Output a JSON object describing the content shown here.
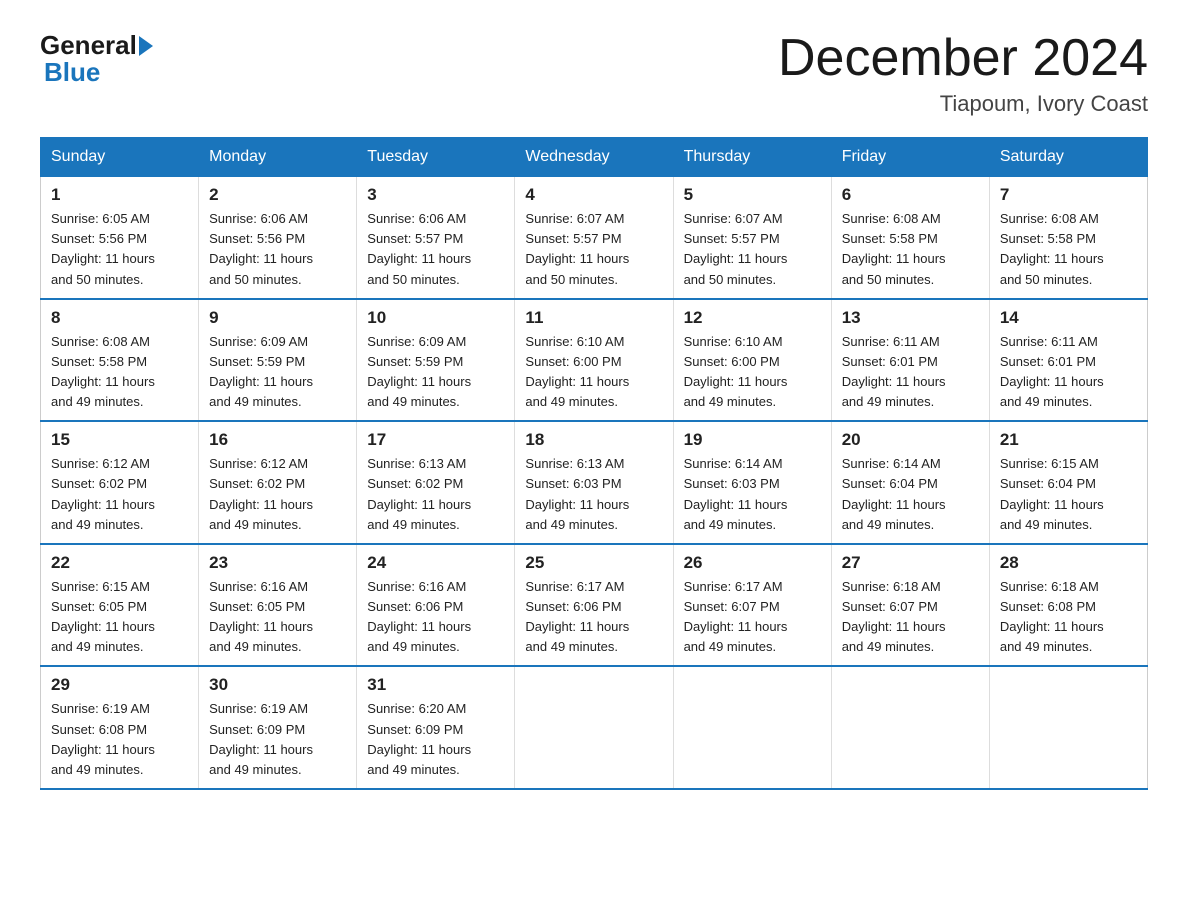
{
  "logo": {
    "general": "General",
    "blue": "Blue"
  },
  "title": "December 2024",
  "location": "Tiapoum, Ivory Coast",
  "headers": [
    "Sunday",
    "Monday",
    "Tuesday",
    "Wednesday",
    "Thursday",
    "Friday",
    "Saturday"
  ],
  "weeks": [
    [
      {
        "day": "1",
        "sunrise": "6:05 AM",
        "sunset": "5:56 PM",
        "daylight": "11 hours and 50 minutes."
      },
      {
        "day": "2",
        "sunrise": "6:06 AM",
        "sunset": "5:56 PM",
        "daylight": "11 hours and 50 minutes."
      },
      {
        "day": "3",
        "sunrise": "6:06 AM",
        "sunset": "5:57 PM",
        "daylight": "11 hours and 50 minutes."
      },
      {
        "day": "4",
        "sunrise": "6:07 AM",
        "sunset": "5:57 PM",
        "daylight": "11 hours and 50 minutes."
      },
      {
        "day": "5",
        "sunrise": "6:07 AM",
        "sunset": "5:57 PM",
        "daylight": "11 hours and 50 minutes."
      },
      {
        "day": "6",
        "sunrise": "6:08 AM",
        "sunset": "5:58 PM",
        "daylight": "11 hours and 50 minutes."
      },
      {
        "day": "7",
        "sunrise": "6:08 AM",
        "sunset": "5:58 PM",
        "daylight": "11 hours and 50 minutes."
      }
    ],
    [
      {
        "day": "8",
        "sunrise": "6:08 AM",
        "sunset": "5:58 PM",
        "daylight": "11 hours and 49 minutes."
      },
      {
        "day": "9",
        "sunrise": "6:09 AM",
        "sunset": "5:59 PM",
        "daylight": "11 hours and 49 minutes."
      },
      {
        "day": "10",
        "sunrise": "6:09 AM",
        "sunset": "5:59 PM",
        "daylight": "11 hours and 49 minutes."
      },
      {
        "day": "11",
        "sunrise": "6:10 AM",
        "sunset": "6:00 PM",
        "daylight": "11 hours and 49 minutes."
      },
      {
        "day": "12",
        "sunrise": "6:10 AM",
        "sunset": "6:00 PM",
        "daylight": "11 hours and 49 minutes."
      },
      {
        "day": "13",
        "sunrise": "6:11 AM",
        "sunset": "6:01 PM",
        "daylight": "11 hours and 49 minutes."
      },
      {
        "day": "14",
        "sunrise": "6:11 AM",
        "sunset": "6:01 PM",
        "daylight": "11 hours and 49 minutes."
      }
    ],
    [
      {
        "day": "15",
        "sunrise": "6:12 AM",
        "sunset": "6:02 PM",
        "daylight": "11 hours and 49 minutes."
      },
      {
        "day": "16",
        "sunrise": "6:12 AM",
        "sunset": "6:02 PM",
        "daylight": "11 hours and 49 minutes."
      },
      {
        "day": "17",
        "sunrise": "6:13 AM",
        "sunset": "6:02 PM",
        "daylight": "11 hours and 49 minutes."
      },
      {
        "day": "18",
        "sunrise": "6:13 AM",
        "sunset": "6:03 PM",
        "daylight": "11 hours and 49 minutes."
      },
      {
        "day": "19",
        "sunrise": "6:14 AM",
        "sunset": "6:03 PM",
        "daylight": "11 hours and 49 minutes."
      },
      {
        "day": "20",
        "sunrise": "6:14 AM",
        "sunset": "6:04 PM",
        "daylight": "11 hours and 49 minutes."
      },
      {
        "day": "21",
        "sunrise": "6:15 AM",
        "sunset": "6:04 PM",
        "daylight": "11 hours and 49 minutes."
      }
    ],
    [
      {
        "day": "22",
        "sunrise": "6:15 AM",
        "sunset": "6:05 PM",
        "daylight": "11 hours and 49 minutes."
      },
      {
        "day": "23",
        "sunrise": "6:16 AM",
        "sunset": "6:05 PM",
        "daylight": "11 hours and 49 minutes."
      },
      {
        "day": "24",
        "sunrise": "6:16 AM",
        "sunset": "6:06 PM",
        "daylight": "11 hours and 49 minutes."
      },
      {
        "day": "25",
        "sunrise": "6:17 AM",
        "sunset": "6:06 PM",
        "daylight": "11 hours and 49 minutes."
      },
      {
        "day": "26",
        "sunrise": "6:17 AM",
        "sunset": "6:07 PM",
        "daylight": "11 hours and 49 minutes."
      },
      {
        "day": "27",
        "sunrise": "6:18 AM",
        "sunset": "6:07 PM",
        "daylight": "11 hours and 49 minutes."
      },
      {
        "day": "28",
        "sunrise": "6:18 AM",
        "sunset": "6:08 PM",
        "daylight": "11 hours and 49 minutes."
      }
    ],
    [
      {
        "day": "29",
        "sunrise": "6:19 AM",
        "sunset": "6:08 PM",
        "daylight": "11 hours and 49 minutes."
      },
      {
        "day": "30",
        "sunrise": "6:19 AM",
        "sunset": "6:09 PM",
        "daylight": "11 hours and 49 minutes."
      },
      {
        "day": "31",
        "sunrise": "6:20 AM",
        "sunset": "6:09 PM",
        "daylight": "11 hours and 49 minutes."
      },
      null,
      null,
      null,
      null
    ]
  ]
}
